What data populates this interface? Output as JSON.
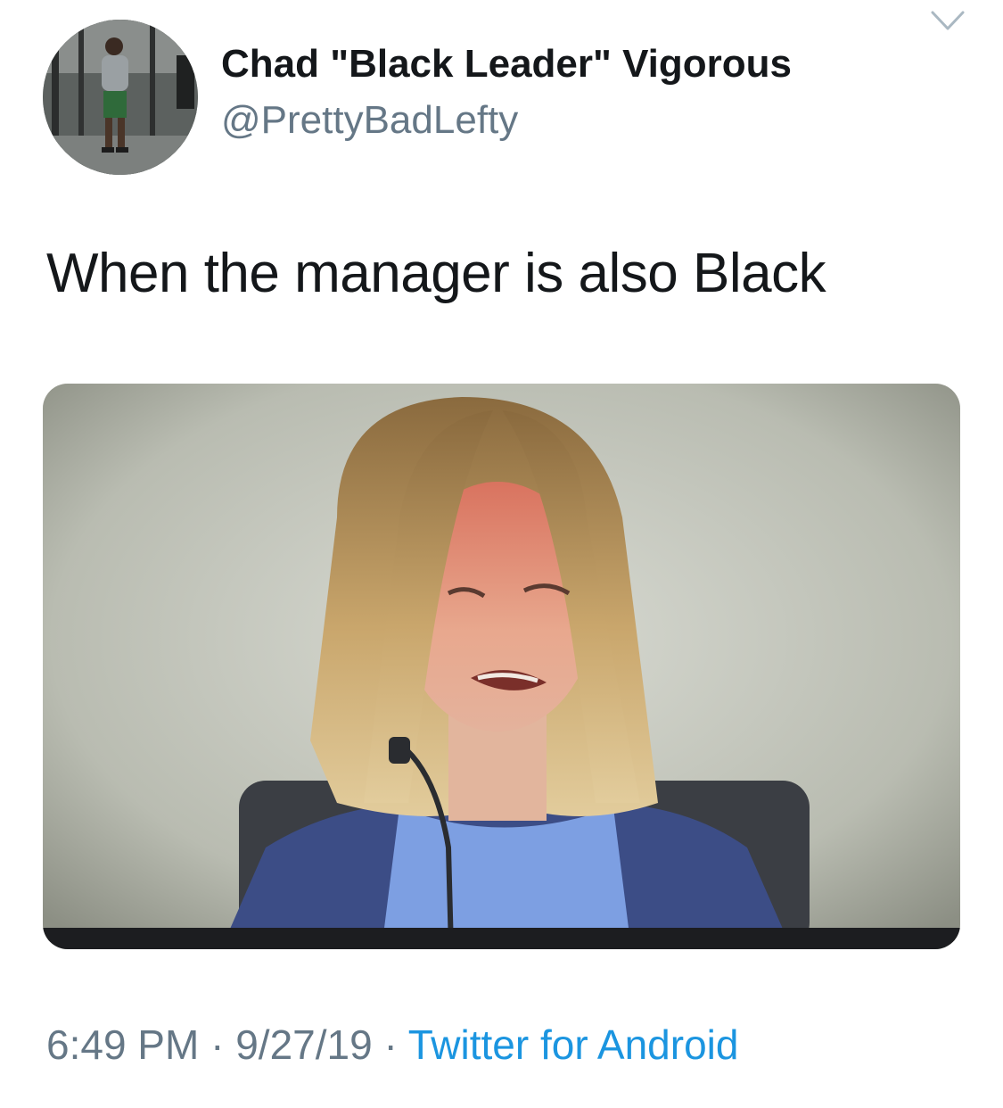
{
  "user": {
    "display_name": "Chad \"Black Leader\" Vigorous",
    "handle": "@PrettyBadLefty"
  },
  "tweet": {
    "text": "When the manager is also Black"
  },
  "meta": {
    "time": "6:49 PM",
    "separator": " · ",
    "date": "9/27/19",
    "source": "Twitter for Android"
  },
  "icons": {
    "menu": "chevron-down-icon"
  },
  "colors": {
    "name": "#14171a",
    "secondary": "#657786",
    "link": "#1b95e0"
  }
}
